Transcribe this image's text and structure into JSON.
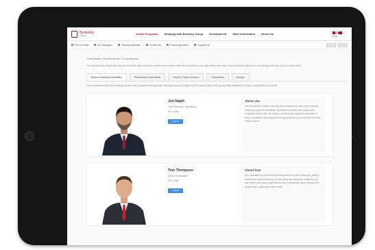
{
  "nav": {
    "logo_text": "Berkeley",
    "logo_sub": "College",
    "items": [
      "Online Programs",
      "Studying with Berkeley Group",
      "Development",
      "More Information",
      "About Us"
    ],
    "badge_sub": "GIVE"
  },
  "toolbar": {
    "items": [
      "Print & Email",
      "For Managers",
      "Training Materials",
      "Contact Us",
      "Frequently Asked",
      "Contact Us"
    ]
  },
  "breadcrumb": "Consultants / Professionals / Consultations",
  "intro": "Our professional consultants help you build the skills needed to thrive in your career. Meet the members of our team below and learn more about the experience and background they bring to every client.",
  "tabs": [
    "Board & Advising Committee",
    "Professional Consultants",
    "Student Career Advisors",
    "Consultants",
    "Industry"
  ],
  "tab_description": "Our consultants work with students across every program and specialty, sharing real-world insight into the career paths and opportunities available in today's competitive job market.",
  "people": [
    {
      "name": "Jon Najafi",
      "role": "Vice President, Operations",
      "phone": "Ext. 1234",
      "button": "Contact",
      "about_title": "About Jon",
      "about_text": "Jon has worked in career services and consulting for many years, helping students prepare for interviews, strengthen resumes and connect with employers in their field. He brings a practical and supportive approach to every consultation and enjoys mentoring students as they take the next step in their careers."
    },
    {
      "name": "Tom Thompson",
      "role": "Senior Consultant",
      "phone": "Ext. 2345",
      "button": "Contact",
      "about_title": "About Tom",
      "about_text": "Tom specializes in professional development and career planning, guiding students through networking, job searching and workplace readiness. He has worked with many organizations and is passionate about helping each student find a meaningful career path."
    }
  ],
  "colors": {
    "brand": "#a01c2a",
    "button": "#4a90d9",
    "tablet_bezel": "#151515"
  }
}
